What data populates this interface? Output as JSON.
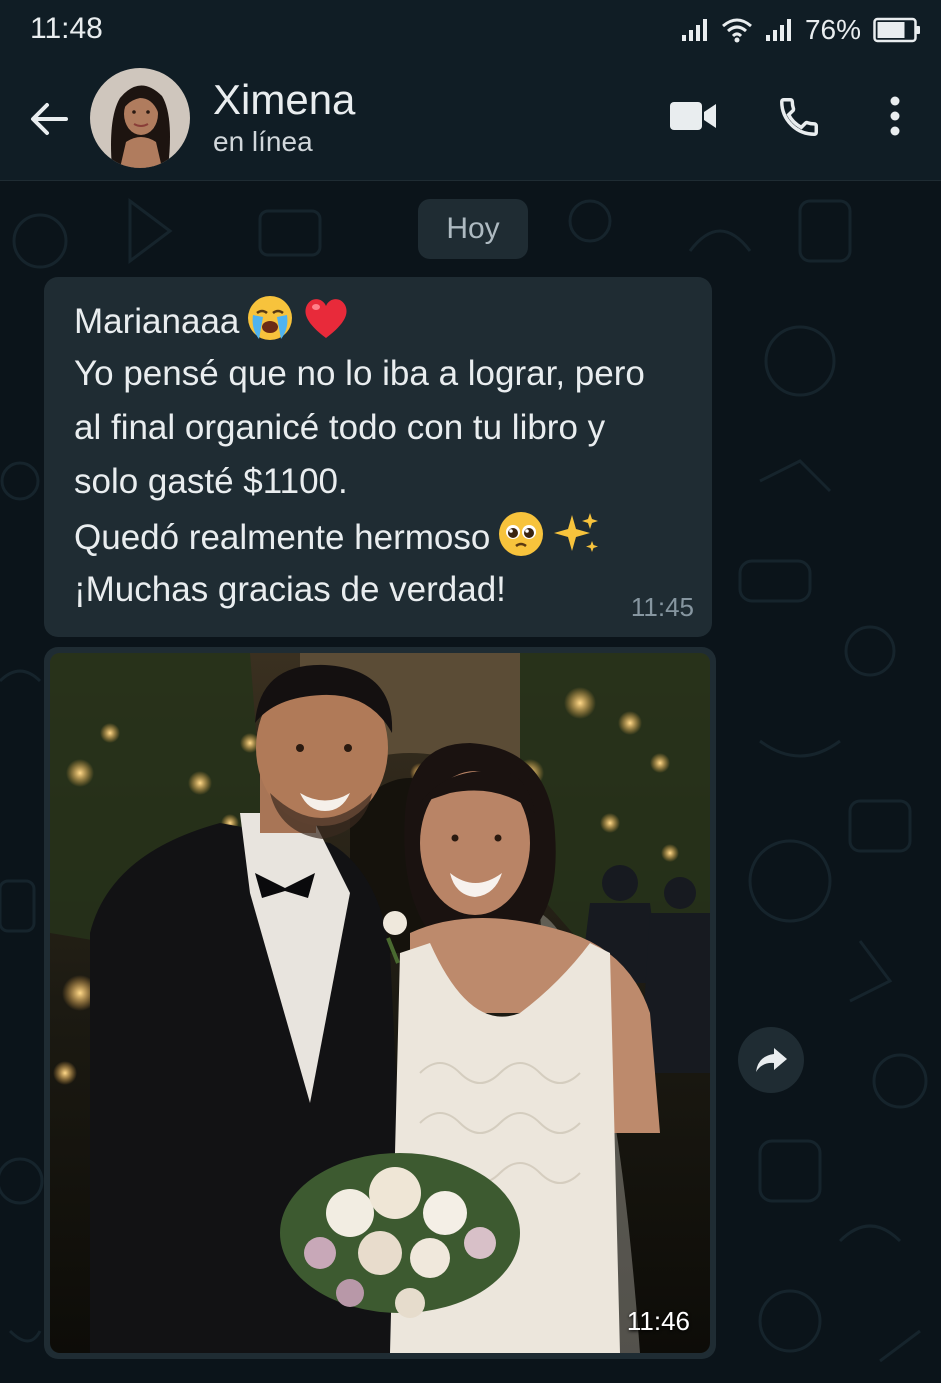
{
  "status_bar": {
    "time": "11:48",
    "battery": "76%"
  },
  "header": {
    "contact_name": "Ximena",
    "contact_status": "en línea"
  },
  "chat": {
    "date_chip": "Hoy",
    "messages": [
      {
        "lines": [
          "Marianaaa",
          "Yo pensé que no lo iba a lograr, pero",
          "al final organicé todo con tu libro y",
          "solo gasté $1100.",
          "Quedó realmente hermoso",
          "¡Muchas gracias de verdad!"
        ],
        "emojis_line1": [
          "loudly-crying-face",
          "red-heart"
        ],
        "emojis_line5": [
          "pleading-face",
          "sparkles"
        ],
        "time": "11:45"
      },
      {
        "type": "image",
        "image_icon": "wedding-couple-photo",
        "time": "11:46"
      }
    ]
  },
  "colors": {
    "background": "#0b141a",
    "header": "#101d25",
    "bubble": "#1f2c33",
    "text": "#e9edef",
    "meta": "#8696a0"
  },
  "icons": [
    "back-arrow-icon",
    "video-call-icon",
    "phone-icon",
    "more-vert-icon",
    "forward-icon",
    "signal-icon",
    "wifi-icon",
    "battery-icon"
  ]
}
